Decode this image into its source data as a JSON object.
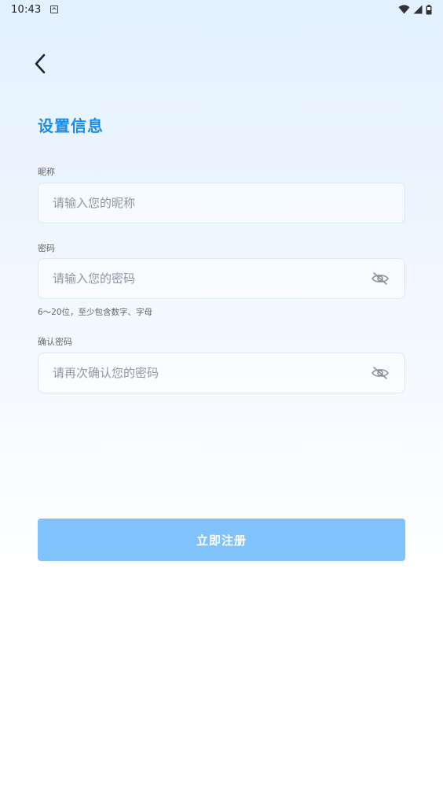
{
  "status_bar": {
    "time": "10:43",
    "icons": [
      "app-notification-icon",
      "wifi-icon",
      "cell-signal-icon",
      "battery-icon"
    ]
  },
  "page": {
    "title": "设置信息",
    "back_icon": "chevron-left-icon"
  },
  "form": {
    "nickname": {
      "label": "昵称",
      "placeholder": "请输入您的昵称",
      "value": ""
    },
    "password": {
      "label": "密码",
      "placeholder": "请输入您的密码",
      "value": "",
      "hint": "6～20位，至少包含数字、字母"
    },
    "confirm_password": {
      "label": "确认密码",
      "placeholder": "请再次确认您的密码",
      "value": ""
    },
    "visibility_icon": "eye-hidden-icon"
  },
  "actions": {
    "register_label": "立即注册"
  },
  "colors": {
    "accent": "#1a8cf0",
    "button": "#80c2fc",
    "background_top": "#e3f1fe",
    "background_bottom": "#ffffff"
  }
}
